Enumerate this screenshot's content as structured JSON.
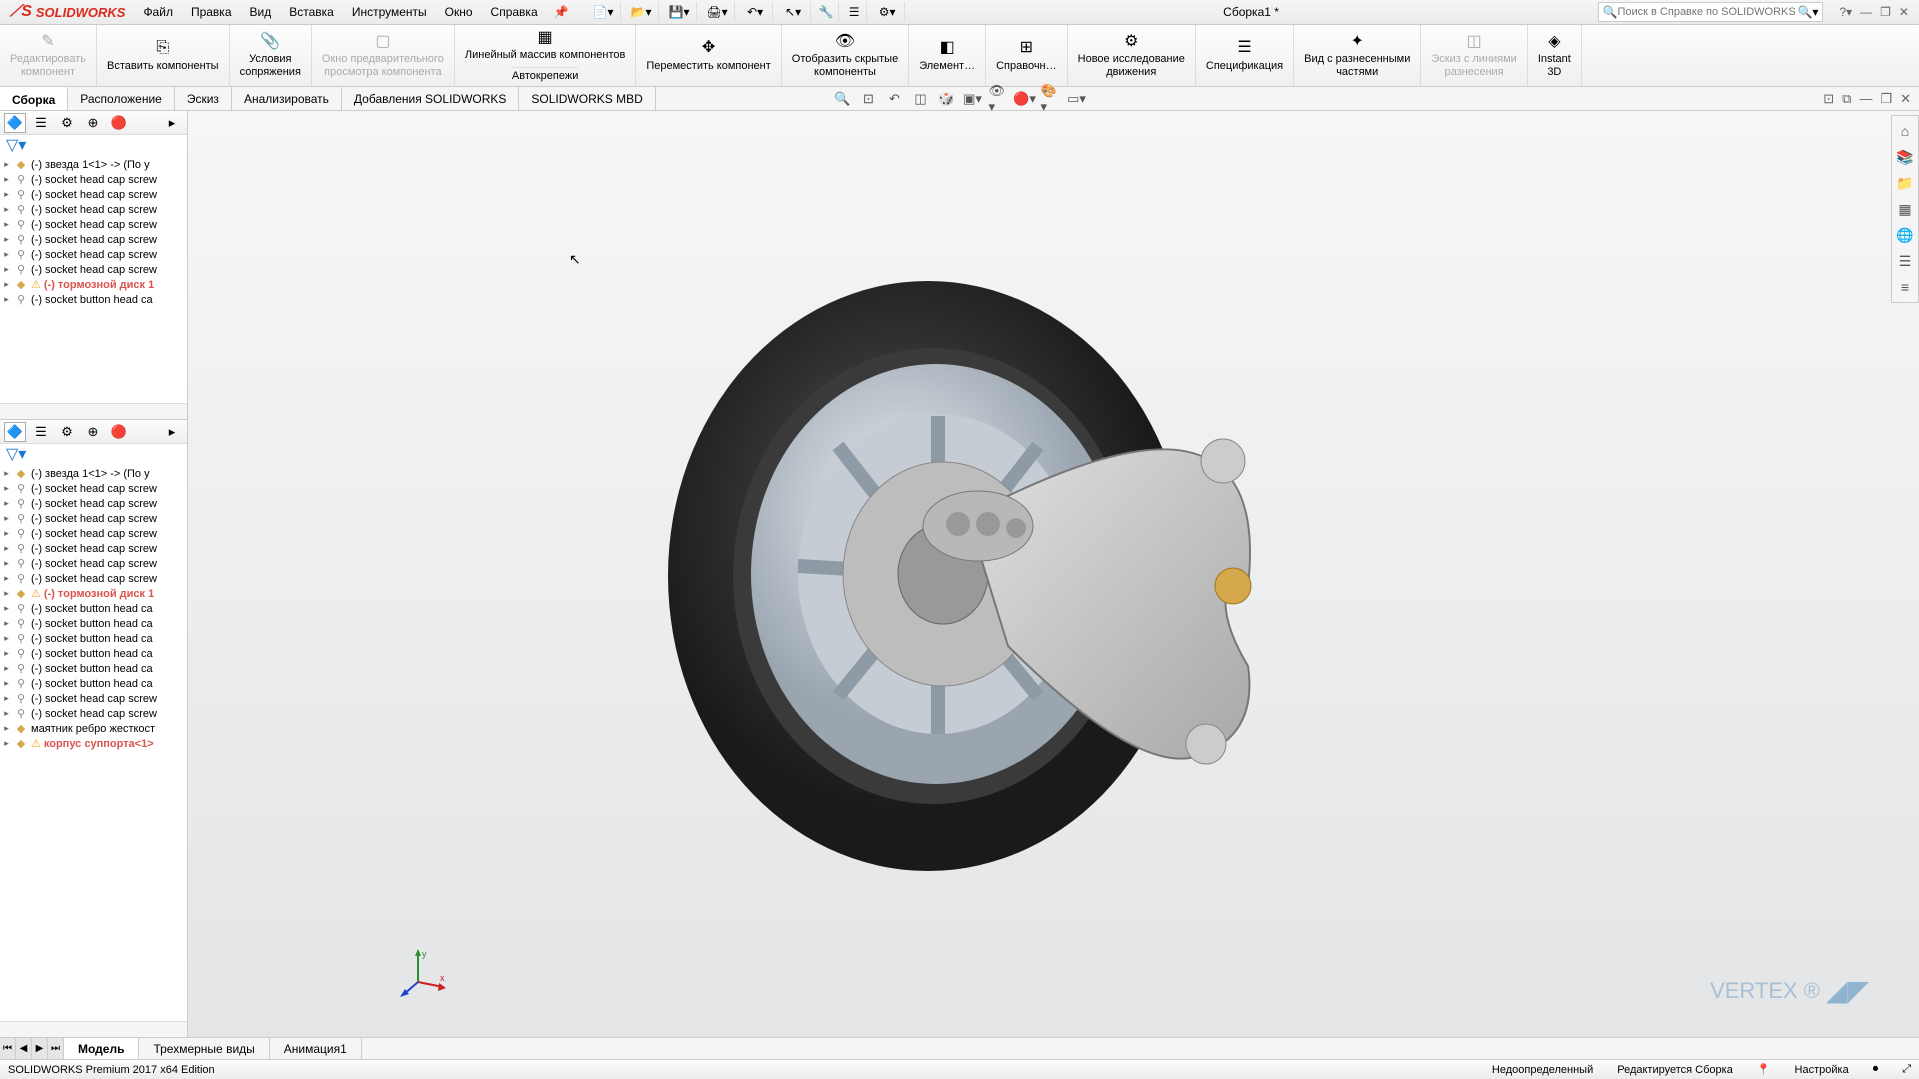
{
  "app": {
    "logo_text": "SOLIDWORKS",
    "doc_title": "Сборка1 *",
    "search_placeholder": "Поиск в Справке по SOLIDWORKS"
  },
  "menus": [
    "Файл",
    "Правка",
    "Вид",
    "Вставка",
    "Инструменты",
    "Окно",
    "Справка"
  ],
  "ribbon": [
    {
      "label": "Редактировать\nкомпонент",
      "disabled": true,
      "icon": "✎"
    },
    {
      "label": "Вставить компоненты",
      "icon": "⎘"
    },
    {
      "label": "Условия\nсопряжения",
      "icon": "📎"
    },
    {
      "label": "Окно предварительного\nпросмотра компонента",
      "disabled": true,
      "icon": "▢"
    },
    {
      "label": "Линейный массив компонентов",
      "icon": "▦",
      "sub": "Автокрепежи"
    },
    {
      "label": "Переместить компонент",
      "icon": "✥"
    },
    {
      "label": "Отобразить скрытые\nкомпоненты",
      "icon": "👁"
    },
    {
      "label": "Элемент…",
      "icon": "◧"
    },
    {
      "label": "Справочн…",
      "icon": "⊞"
    },
    {
      "label": "Новое исследование\nдвижения",
      "icon": "⚙"
    },
    {
      "label": "Спецификация",
      "icon": "☰"
    },
    {
      "label": "Вид с разнесенными\nчастями",
      "icon": "✦"
    },
    {
      "label": "Эскиз с линиями\nразнесения",
      "disabled": true,
      "icon": "◫"
    },
    {
      "label": "Instant\n3D",
      "icon": "◈"
    }
  ],
  "tabs": [
    "Сборка",
    "Расположение",
    "Эскиз",
    "Анализировать",
    "Добавления SOLIDWORKS",
    "SOLIDWORKS MBD"
  ],
  "tree1": [
    {
      "t": "part-warn",
      "label": "(-) звезда 1<1> -> (По у"
    },
    {
      "t": "fastener",
      "label": "(-) socket head cap screw"
    },
    {
      "t": "fastener",
      "label": "(-) socket head cap screw"
    },
    {
      "t": "fastener",
      "label": "(-) socket head cap screw"
    },
    {
      "t": "fastener",
      "label": "(-) socket head cap screw"
    },
    {
      "t": "fastener",
      "label": "(-) socket head cap screw"
    },
    {
      "t": "fastener",
      "label": "(-) socket head cap screw"
    },
    {
      "t": "fastener",
      "label": "(-) socket head cap screw"
    },
    {
      "t": "part-warn2",
      "label": "(-) тормозной диск 1"
    },
    {
      "t": "fastener",
      "label": "(-) socket button head ca"
    }
  ],
  "tree2": [
    {
      "t": "part-warn",
      "label": "(-) звезда 1<1> -> (По у"
    },
    {
      "t": "fastener",
      "label": "(-) socket head cap screw"
    },
    {
      "t": "fastener",
      "label": "(-) socket head cap screw"
    },
    {
      "t": "fastener",
      "label": "(-) socket head cap screw"
    },
    {
      "t": "fastener",
      "label": "(-) socket head cap screw"
    },
    {
      "t": "fastener",
      "label": "(-) socket head cap screw"
    },
    {
      "t": "fastener",
      "label": "(-) socket head cap screw"
    },
    {
      "t": "fastener",
      "label": "(-) socket head cap screw"
    },
    {
      "t": "part-warn2",
      "label": "(-) тормозной диск 1"
    },
    {
      "t": "fastener",
      "label": "(-) socket button head ca"
    },
    {
      "t": "fastener",
      "label": "(-) socket button head ca"
    },
    {
      "t": "fastener",
      "label": "(-) socket button head ca"
    },
    {
      "t": "fastener",
      "label": "(-) socket button head ca"
    },
    {
      "t": "fastener",
      "label": "(-) socket button head ca"
    },
    {
      "t": "fastener",
      "label": "(-) socket button head ca"
    },
    {
      "t": "fastener",
      "label": "(-) socket head cap screw"
    },
    {
      "t": "fastener",
      "label": "(-) socket head cap screw"
    },
    {
      "t": "part",
      "label": "маятник ребро жесткост"
    },
    {
      "t": "part-warn2",
      "label": "корпус суппорта<1>"
    }
  ],
  "doctabs": [
    "Модель",
    "Трехмерные виды",
    "Анимация1"
  ],
  "status": {
    "edition": "SOLIDWORKS Premium 2017 x64 Edition",
    "defined": "Недоопределенный",
    "editing": "Редактируется Сборка",
    "custom": "Настройка"
  },
  "watermark": "VERTEX"
}
